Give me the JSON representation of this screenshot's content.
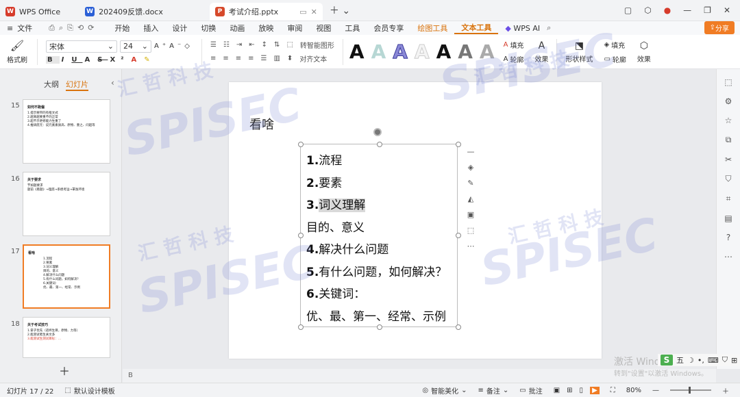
{
  "tabs": [
    {
      "label": "WPS Office",
      "icon": "wps-logo-icon",
      "color": "#d63b2b"
    },
    {
      "label": "202409反馈.docx",
      "icon": "word-doc-icon",
      "color": "#2b5fd6"
    },
    {
      "label": "考试介绍.pptx",
      "icon": "ppt-doc-icon",
      "color": "#d6492b"
    }
  ],
  "menu": {
    "file": "文件",
    "items": [
      "开始",
      "插入",
      "设计",
      "切换",
      "动画",
      "放映",
      "审阅",
      "视图",
      "工具",
      "会员专享"
    ],
    "drawing_tools": "绘图工具",
    "text_tools": "文本工具",
    "wps_ai": "WPS AI",
    "share": "分享"
  },
  "ribbon": {
    "format_painter": "格式刷",
    "font_name": "宋体",
    "font_size": "24",
    "smart_shape": "转智能图形",
    "align_text": "对齐文本",
    "fill": "填充",
    "outline": "轮廓",
    "effect": "效果",
    "shape_style": "形状样式",
    "wordart_letters": [
      "A",
      "A",
      "A",
      "A",
      "A",
      "A",
      "A"
    ]
  },
  "left_panel": {
    "tab_outline": "大纲",
    "tab_slides": "幻灯片",
    "thumbnails": [
      {
        "num": "15",
        "title": "如何不跑偏",
        "lines": [
          "1.提示要带的有框文式",
          "2.越来越要重不的正常",
          "3.超不示更修能力生重了",
          "4.推研底元：说元素素质高、原物、重之、问超等"
        ]
      },
      {
        "num": "16",
        "title": "关于要求",
        "lines": [
          "节如题要求",
          "题前《看题》→理底→系梳考运→罩逸环境"
        ]
      },
      {
        "num": "17",
        "title": "看啥",
        "lines": [
          "1.流程",
          "2.要素",
          "3.词义理解",
          "目的、意义",
          "4.解决什么问题",
          "5.有什么问题，如何解决？",
          "6.关键词：",
          "优、最、第一、经常、示例"
        ]
      },
      {
        "num": "18",
        "title": "关于考试技巧",
        "lines": [
          "1.掌子优先（适终生目，原物、力等）",
          "2.能测试者生关文多",
          "3.能测试生测试目标：..."
        ]
      }
    ]
  },
  "slide": {
    "title": "看啥",
    "lines": [
      {
        "num": "1.",
        "text": "流程"
      },
      {
        "num": "2.",
        "text": "要素"
      },
      {
        "num": "3.",
        "text": "词义理解"
      },
      {
        "num": "",
        "text": "目的、意义"
      },
      {
        "num": "4.",
        "text": "解决什么问题"
      },
      {
        "num": "5.",
        "text": "有什么问题，如何解决？"
      },
      {
        "num": "6.",
        "text": "关键词："
      },
      {
        "num": "",
        "text": "优、最、第一、经常、示例"
      }
    ]
  },
  "notes_placeholder": "B",
  "activate": {
    "title": "激活 Windo",
    "sub": "转到\"设置\"以激活 Windows。"
  },
  "ime": {
    "label": "五"
  },
  "status": {
    "slide_pos": "幻灯片 17 / 22",
    "template": "默认设计模板",
    "beautify": "智能美化",
    "notes": "备注",
    "comments": "批注",
    "zoom": "80%"
  },
  "watermark": {
    "brand": "SPISEC",
    "cn": "汇 哲 科 技"
  },
  "colors": {
    "accent": "#d9730d",
    "share": "#f07c24",
    "selected_border": "#f07c24"
  }
}
